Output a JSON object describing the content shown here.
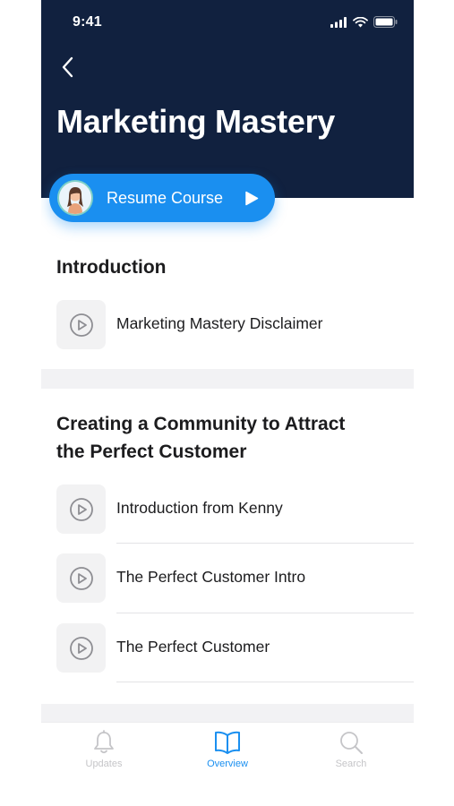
{
  "status_bar": {
    "time": "9:41"
  },
  "header": {
    "title": "Marketing Mastery"
  },
  "resume": {
    "label": "Resume Course"
  },
  "sections": [
    {
      "title": "Introduction",
      "lessons": [
        {
          "label": "Marketing Mastery Disclaimer"
        }
      ]
    },
    {
      "title_line1": "Creating a Community to Attract",
      "title_line2": "the Perfect Customer",
      "lessons": [
        {
          "label": "Introduction from Kenny"
        },
        {
          "label": "The Perfect Customer Intro"
        },
        {
          "label": "The Perfect Customer"
        }
      ]
    }
  ],
  "tabs": [
    {
      "label": "Updates",
      "icon": "bell-icon",
      "active": false
    },
    {
      "label": "Overview",
      "icon": "book-icon",
      "active": true
    },
    {
      "label": "Search",
      "icon": "search-icon",
      "active": false
    }
  ],
  "colors": {
    "header_bg": "#11213f",
    "accent": "#1a8ff0",
    "inactive_tab": "#c5c5c8"
  }
}
